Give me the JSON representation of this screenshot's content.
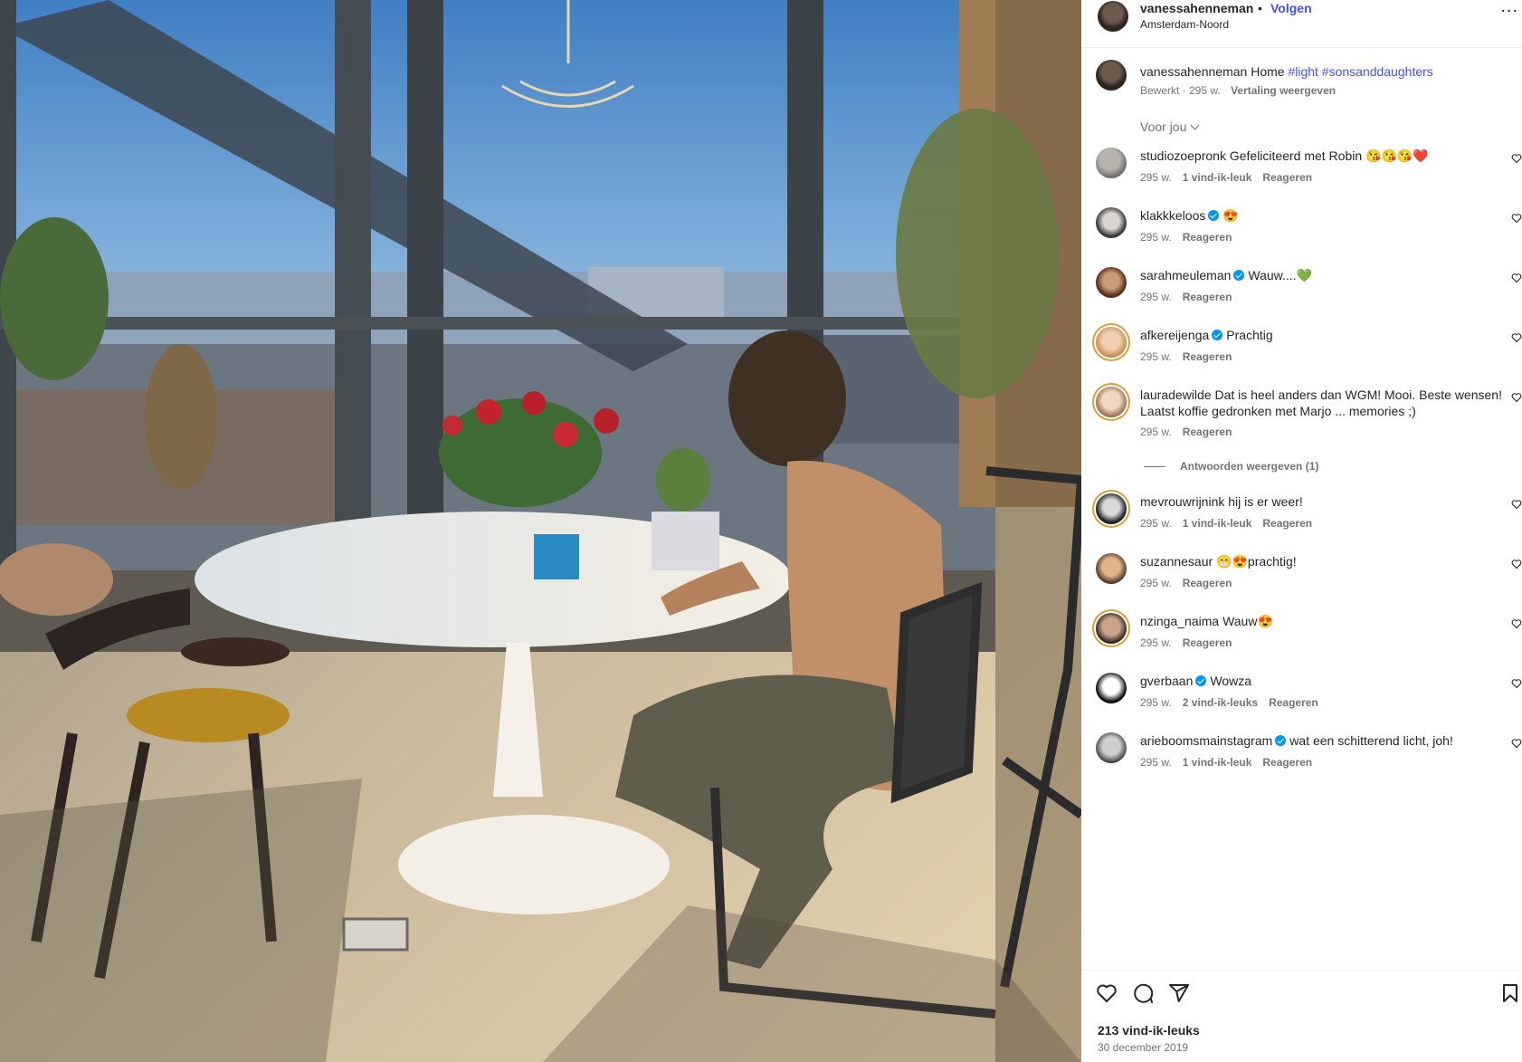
{
  "post": {
    "username": "vanessahenneman",
    "dot": "•",
    "follow_label": "Volgen",
    "location": "Amsterdam-Noord",
    "more_label": "..."
  },
  "caption": {
    "username": "vanessahenneman",
    "text": "Home",
    "hashtags": "#light #sonsanddaughters",
    "edited": "Bewerkt · 295 w.",
    "translate_label": "Vertaling weergeven"
  },
  "sort_label": "Voor jou",
  "comments": [
    {
      "username": "studiozoepronk",
      "verified": false,
      "text": "Gefeliciteerd met Robin 😘😘😘❤️",
      "time": "295 w.",
      "likes": "1 vind-ik-leuk",
      "reply": "Reageren"
    },
    {
      "username": "klakkkeloos",
      "verified": true,
      "text": "😍",
      "time": "295 w.",
      "likes": "",
      "reply": "Reageren"
    },
    {
      "username": "sarahmeuleman",
      "verified": true,
      "text": "Wauw....💚",
      "time": "295 w.",
      "likes": "",
      "reply": "Reageren"
    },
    {
      "username": "afkereijenga",
      "verified": true,
      "text": "Prachtig",
      "time": "295 w.",
      "likes": "",
      "reply": "Reageren"
    },
    {
      "username": "lauradewilde",
      "verified": false,
      "text": "Dat is heel anders dan WGM! Mooi. Beste wensen! Laatst koffie gedronken met Marjo ... memories ;)",
      "time": "295 w.",
      "likes": "",
      "reply": "Reageren"
    },
    {
      "username": "mevrouwrijnink",
      "verified": false,
      "text": "hij is er weer!",
      "time": "295 w.",
      "likes": "1 vind-ik-leuk",
      "reply": "Reageren"
    },
    {
      "username": "suzannesaur",
      "verified": false,
      "text": "😁😍prachtig!",
      "time": "295 w.",
      "likes": "",
      "reply": "Reageren"
    },
    {
      "username": "nzinga_naima",
      "verified": false,
      "text": "Wauw😍",
      "time": "295 w.",
      "likes": "",
      "reply": "Reageren"
    },
    {
      "username": "gverbaan",
      "verified": true,
      "text": "Wowza",
      "time": "295 w.",
      "likes": "2 vind-ik-leuks",
      "reply": "Reageren"
    },
    {
      "username": "arieboomsmainstagram",
      "verified": true,
      "text": "wat een schitterend licht, joh!",
      "time": "295 w.",
      "likes": "1 vind-ik-leuk",
      "reply": "Reageren"
    }
  ],
  "replies_label": "Antwoorden weergeven (1)",
  "footer": {
    "likes": "213 vind-ik-leuks",
    "date": "30 december 2019"
  },
  "icons": [
    "heart-icon",
    "comment-icon",
    "share-icon",
    "bookmark-icon",
    "verified-badge-icon",
    "more-icon",
    "chevron-down-icon"
  ],
  "colors": {
    "link": "#4150f7",
    "verified": "#0095f6",
    "secondary_text": "#737373",
    "text": "#262626"
  }
}
